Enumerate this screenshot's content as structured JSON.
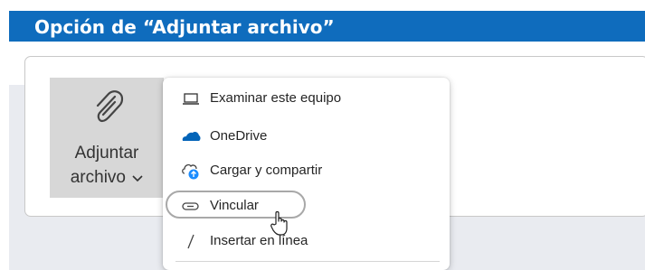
{
  "header": {
    "title": "Opción de “Adjuntar archivo”"
  },
  "attach_button": {
    "line1": "Adjuntar",
    "line2": "archivo",
    "icon": "paperclip-icon",
    "chevron_icon": "chevron-down-icon"
  },
  "menu": {
    "items": [
      {
        "label": "Examinar este equipo",
        "icon": "laptop-icon"
      },
      {
        "label": "OneDrive",
        "icon": "onedrive-cloud-icon"
      },
      {
        "label": "Cargar y compartir",
        "icon": "cloud-upload-icon"
      },
      {
        "label": "Vincular",
        "icon": "link-icon"
      },
      {
        "label": "Insertar en línea",
        "icon": "slash-icon"
      }
    ],
    "highlighted_item": "Vincular"
  },
  "colors": {
    "title_bar": "#0f6cbd",
    "onedrive": "#0364b8",
    "upload_badge": "#1a8cff"
  }
}
